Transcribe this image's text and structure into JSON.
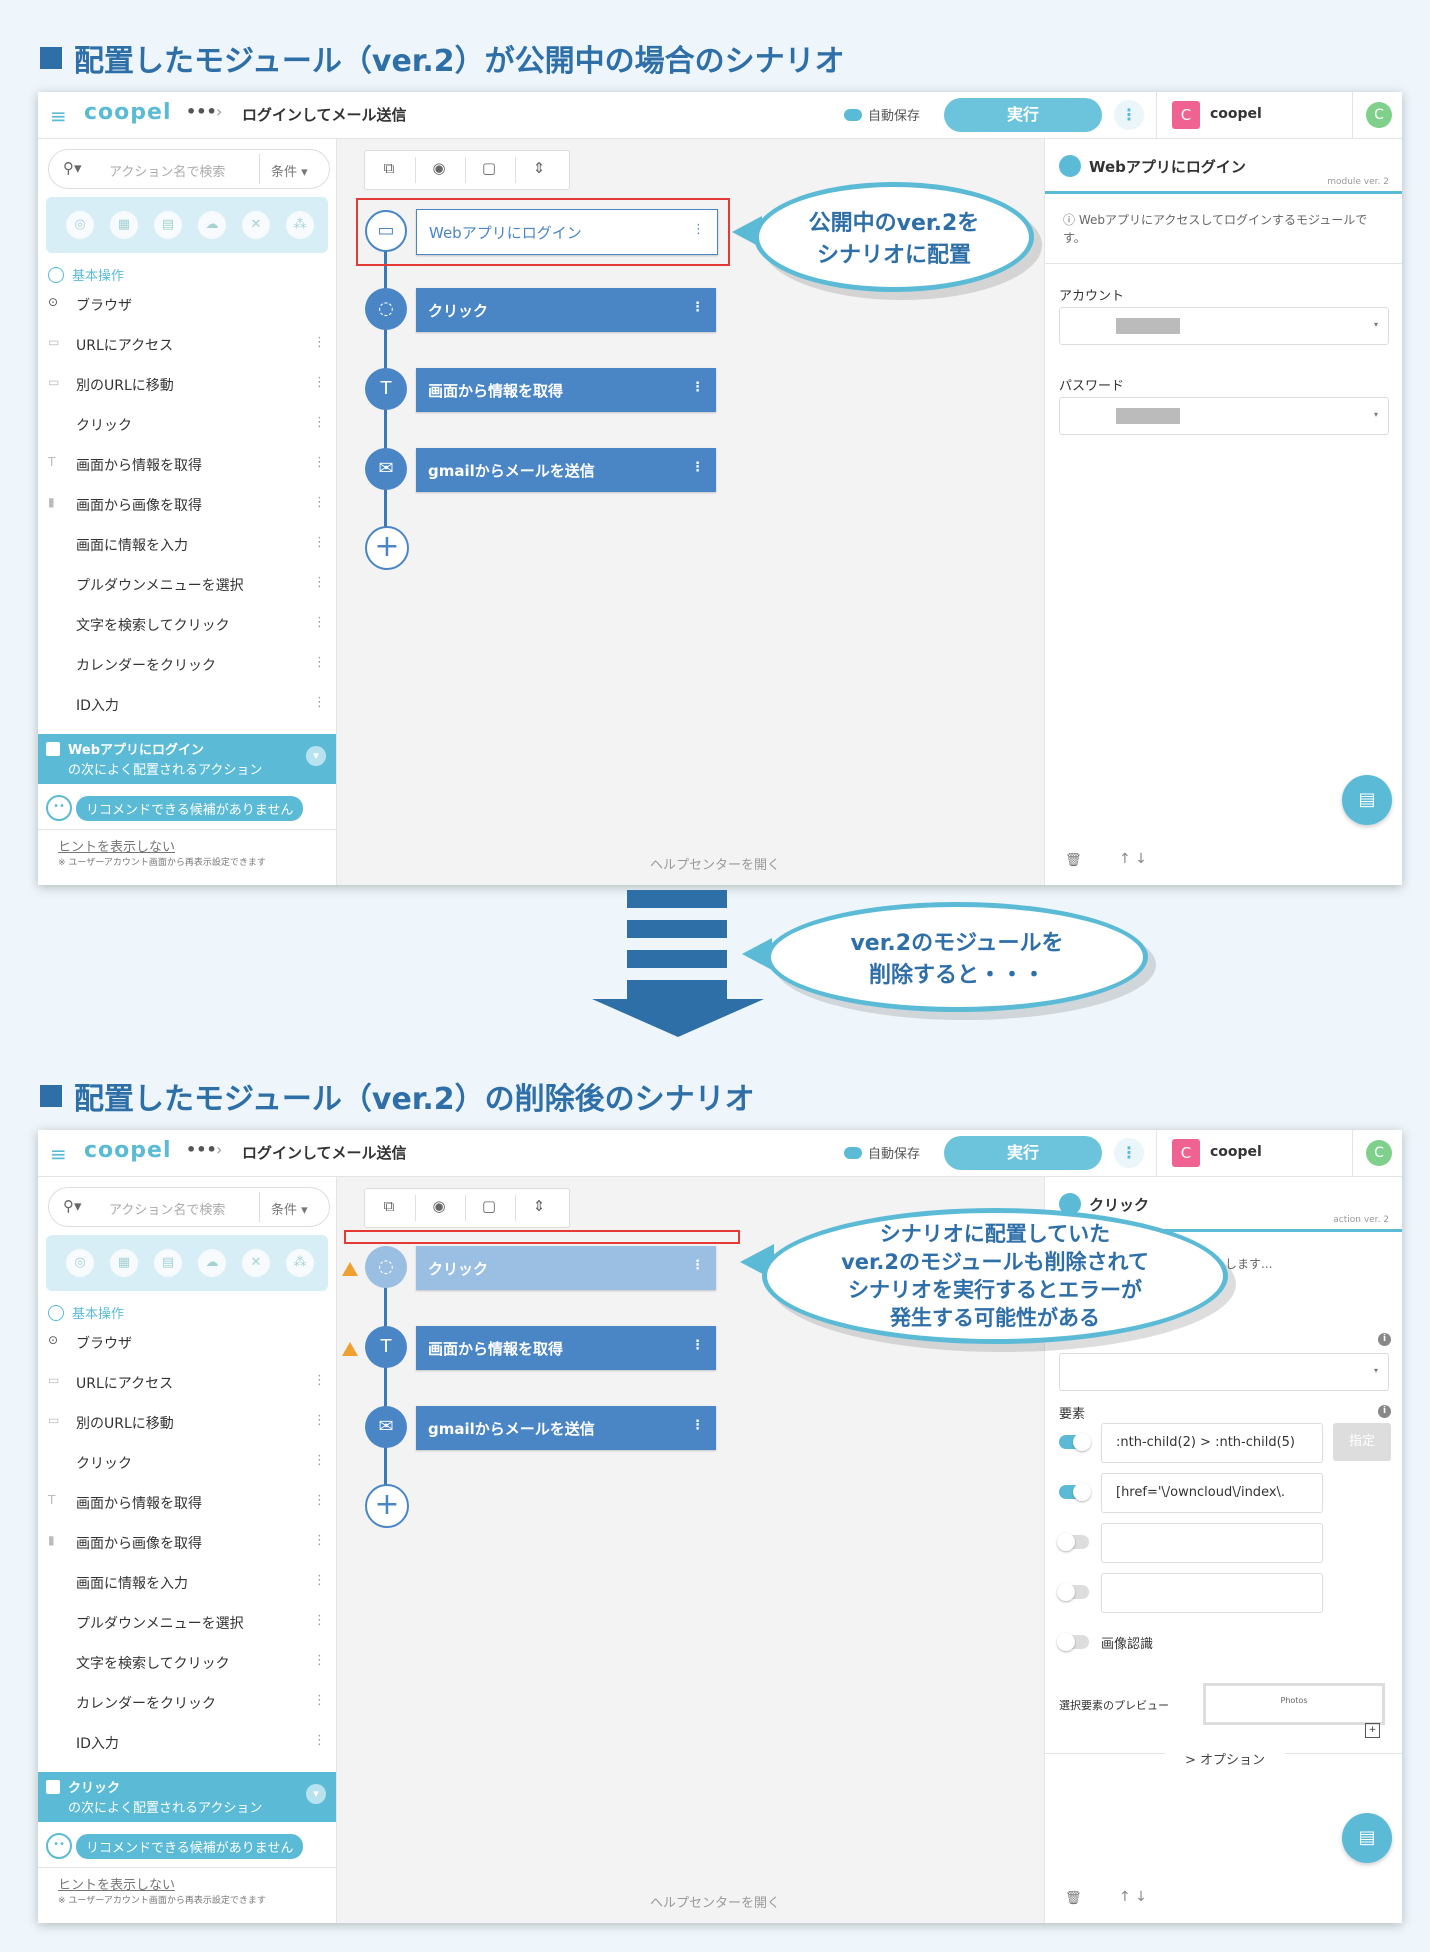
{
  "heading1": "配置したモジュール（ver.2）が公開中の場合のシナリオ",
  "heading2": "配置したモジュール（ver.2）の削除後のシナリオ",
  "arrow_callout": "ver.2のモジュールを\n削除すると・・・",
  "app": {
    "logo": "coopel",
    "menu_icon": "hamburger-icon",
    "dots": "•••",
    "breadcrumb": "ログインしてメール送信",
    "autosave": "自動保存",
    "run": "実行",
    "kebab": "⋮",
    "user_initial": "C",
    "user_name": "coopel",
    "user_badge": "C",
    "search_placeholder": "アクション名で検索",
    "condition": "条件",
    "category": "基本操作",
    "browser": "ブラウザ",
    "actions": [
      "URLにアクセス",
      "別のURLに移動",
      "クリック",
      "画面から情報を取得",
      "画面から画像を取得",
      "画面に情報を入力",
      "プルダウンメニューを選択",
      "文字を検索してクリック",
      "カレンダーをクリック",
      "ID入力"
    ],
    "reco_suffix": "の次によく配置されるアクション",
    "no_candidates": "リコメンドできる候補がありません",
    "hint_hide": "ヒントを表示しない",
    "hint_note": "※ ユーザーアカウント画面から再表示設定できます",
    "help_center": "ヘルプセンターを開く"
  },
  "screen1": {
    "callout": "公開中のver.2を\nシナリオに配置",
    "reco_title": "Webアプリにログイン",
    "nodes": [
      "Webアプリにログイン",
      "クリック",
      "画面から情報を取得",
      "gmailからメールを送信"
    ],
    "panel": {
      "title": "Webアプリにログイン",
      "version": "module ver. 2",
      "desc": "Webアプリにアクセスしてログインするモジュールです。",
      "account_label": "アカウント",
      "password_label": "パスワード"
    }
  },
  "screen2": {
    "callout": "シナリオに配置していた\nver.2のモジュールも削除されて\nシナリオを実行するとエラーが\n発生する可能性がある",
    "reco_title": "クリック",
    "nodes": [
      "クリック",
      "画面から情報を取得",
      "gmailからメールを送信"
    ],
    "panel": {
      "title": "クリック",
      "version": "action ver. 2",
      "desc_fragment": "します...",
      "element_label": "要素",
      "selector1": ":nth-child(2) > :nth-child(5)",
      "selector2": "[href='\\/owncloud\\/index\\.",
      "specify": "指定",
      "image_recognition": "画像認識",
      "preview_label": "選択要素のプレビュー",
      "preview_text": "Photos",
      "options": "> オプション"
    }
  },
  "colors": {
    "accent": "#5bbbd6",
    "primary": "#2f6fa8",
    "node": "#4a86c5",
    "warning": "#f0a030",
    "error_box": "#e53935"
  }
}
